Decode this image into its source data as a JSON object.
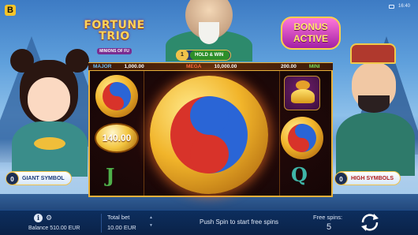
{
  "game": {
    "logo": {
      "title_line1": "FORTUNE",
      "title_line2": "TRIO",
      "subtitle": "MINIONS OF FU"
    },
    "bonus_badge": {
      "line1": "BONUS",
      "line2": "ACTIVE"
    },
    "hold_and_win": {
      "count": "1",
      "label": "HOLD & WIN"
    },
    "jackpots": [
      {
        "label": "MAJOR",
        "value": "1,000.00",
        "color": "#6fbef5"
      },
      {
        "label": "MEGA",
        "value": "10,000.00",
        "color": "#ff6a3c"
      },
      {
        "label": "MINI",
        "value": "200.00",
        "color": "#7fe35a"
      }
    ],
    "features": {
      "left": {
        "count": "0",
        "label": "GIANT SYMBOL"
      },
      "right": {
        "count": "0",
        "label": "HIGH SYMBOLS"
      }
    },
    "reels": {
      "coin_value": "140.00",
      "symbols_visible": [
        "yin-yang",
        "coin",
        "J",
        "giant-yin-yang",
        "gold-ingot",
        "yin-yang",
        "Q"
      ]
    }
  },
  "status_bar": {
    "brand_icon": "B",
    "time": "16:40"
  },
  "bottom_bar": {
    "balance": "Balance 510.00 EUR",
    "total_bet_label": "Total bet",
    "total_bet_value": "10.00 EUR",
    "message": "Push Spin to start free spins",
    "free_spins_label": "Free spins:",
    "free_spins_value": "5",
    "icons": [
      "info-icon",
      "gear-icon",
      "spin-icon"
    ]
  }
}
